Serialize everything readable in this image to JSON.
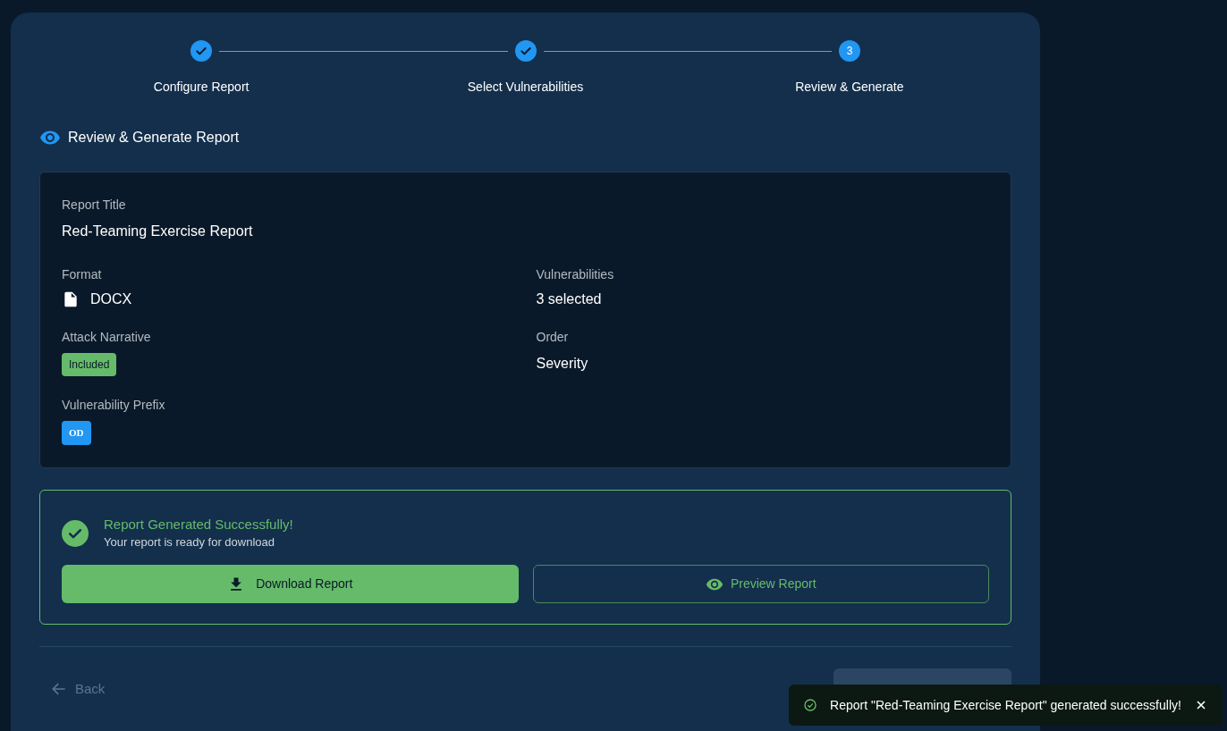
{
  "steps": [
    {
      "label": "Configure Report",
      "completed": true
    },
    {
      "label": "Select Vulnerabilities",
      "completed": true
    },
    {
      "label": "Review & Generate",
      "completed": false,
      "number": "3"
    }
  ],
  "section_title": "Review & Generate Report",
  "summary": {
    "report_title": {
      "label": "Report Title",
      "value": "Red-Teaming Exercise Report"
    },
    "format": {
      "label": "Format",
      "value": "DOCX"
    },
    "vulnerabilities": {
      "label": "Vulnerabilities",
      "value": "3 selected"
    },
    "attack_narrative": {
      "label": "Attack Narrative",
      "badge": "Included"
    },
    "order": {
      "label": "Order",
      "value": "Severity"
    },
    "vulnerability_prefix": {
      "label": "Vulnerability Prefix",
      "badge": "OD"
    }
  },
  "success": {
    "title": "Report Generated Successfully!",
    "message": "Your report is ready for download",
    "download_button": "Download Report",
    "preview_button": "Preview Report"
  },
  "footer": {
    "back_button": {
      "label": "Back",
      "disabled": true
    },
    "generate_button": {
      "disabled": true
    }
  },
  "toast": {
    "message": "Report \"Red-Teaming Exercise Report\" generated successfully!"
  }
}
